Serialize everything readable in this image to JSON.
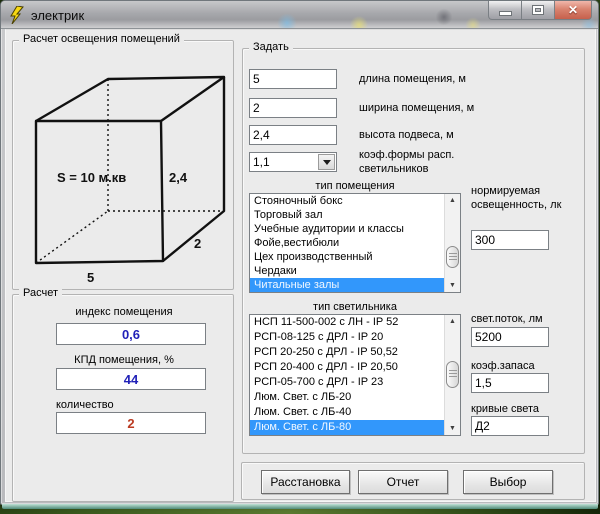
{
  "window": {
    "title": "электрик"
  },
  "colors": {
    "selection_blue": "#3297fb",
    "value_blue": "#2121b8",
    "value_red": "#bb3b22",
    "client_grey": "#ebebeb",
    "desktop_green": "#3a5a1e"
  },
  "diagram_group": {
    "title": "Расчет освещения помещений",
    "cube": {
      "area": "S = 10 м.кв",
      "height": "2,4",
      "depth": "2",
      "width": "5"
    }
  },
  "calc_group": {
    "title": "Расчет",
    "fields": [
      {
        "label": "индекс помещения",
        "value": "0,6"
      },
      {
        "label": "КПД помещения, %",
        "value": "44"
      },
      {
        "label": "количество",
        "value": "2"
      }
    ]
  },
  "set_group": {
    "title": "Задать",
    "inputs": [
      {
        "value": "5",
        "label": "длина помещения, м"
      },
      {
        "value": "2",
        "label": "ширина помещения, м"
      },
      {
        "value": "2,4",
        "label": "высота подвеса, м"
      },
      {
        "value": "1,1",
        "label": "коэф.формы расп. светильников"
      }
    ],
    "room_type": {
      "label": "тип помещения",
      "items": [
        "Стояночный бокс",
        "Торговый зал",
        "Учебные аудитории и классы",
        "Фойе,вестибюли",
        "Цех производственный",
        "Чердаки",
        "Читальные залы"
      ],
      "selected": "Читальные залы"
    },
    "illuminance": {
      "label": "нормируемая освещенность, лк",
      "value": "300"
    },
    "luminaire_type": {
      "label": "тип светильника",
      "items": [
        "НСП 11-500-002 с ЛН - IP 52",
        "РСП-08-125 с ДРЛ - IP 20",
        "РСП 20-250 с ДРЛ - IP 50,52",
        "РСП 20-400 с ДРЛ - IP 20,50",
        "РСП-05-700 с ДРЛ - IP 23",
        "Люм. Свет. с ЛБ-20",
        "Люм. Свет. с ЛБ-40",
        "Люм. Свет. с ЛБ-80"
      ],
      "selected": "Люм. Свет. с ЛБ-80"
    },
    "flux": {
      "label": "свет.поток, лм",
      "value": "5200"
    },
    "safety": {
      "label": "коэф.запаса",
      "value": "1,5"
    },
    "curves": {
      "label": "кривые света",
      "value": "Д2"
    }
  },
  "actions": {
    "buttons": [
      "Расстановка",
      "Отчет",
      "Выбор"
    ]
  }
}
